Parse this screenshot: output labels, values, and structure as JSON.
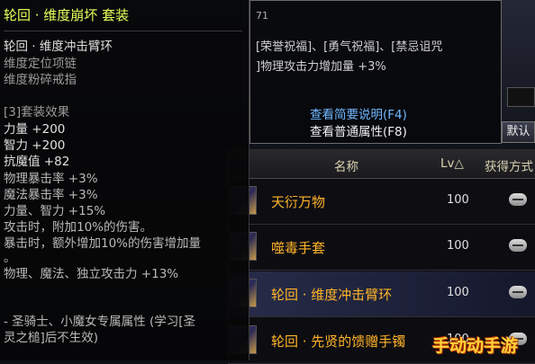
{
  "left_tooltip": {
    "title": "轮回 · 维度崩坏  套装",
    "items": [
      "轮回 · 维度冲击臂环",
      "维度定位项链",
      "维度粉碎戒指"
    ],
    "set_effect_header": "[3]套装效果",
    "stats": [
      "力量 +200",
      "智力 +200",
      "抗魔值 +82",
      "物理暴击率 +3%",
      "魔法暴击率 +3%",
      "力量、智力 +15%",
      "攻击时，附加10%的伤害。",
      "暴击时，额外增加10%的伤害增加量",
      "。",
      "物理、魔法、独立攻击力 +13%"
    ],
    "class_note_1": "- 圣骑士、小魔女专属属性 (学习[圣",
    "class_note_2": "灵之槌]后不生效)"
  },
  "right_tooltip": {
    "number": "71",
    "line1": "[荣誉祝福]、[勇气祝福]、[禁忌诅咒",
    "line2": "]物理攻击力增加量 +3%",
    "link_brief": "查看简要说明(F4)",
    "link_normal": "查看普通属性(F8)"
  },
  "controls": {
    "default_label": "默认"
  },
  "table": {
    "headers": {
      "name": "名称",
      "lv": "Lv△",
      "source": "获得方式"
    },
    "rows": [
      {
        "name": "天衍万物",
        "lv": "100"
      },
      {
        "name": "噬毒手套",
        "lv": "100"
      },
      {
        "name": "轮回 · 维度冲击臂环",
        "lv": "100"
      },
      {
        "name": "轮回 · 先贤的馈赠手镯",
        "lv": "100"
      }
    ],
    "name_color": "#ffb428",
    "selected_row_index": 2
  },
  "watermark": "手动动手游"
}
